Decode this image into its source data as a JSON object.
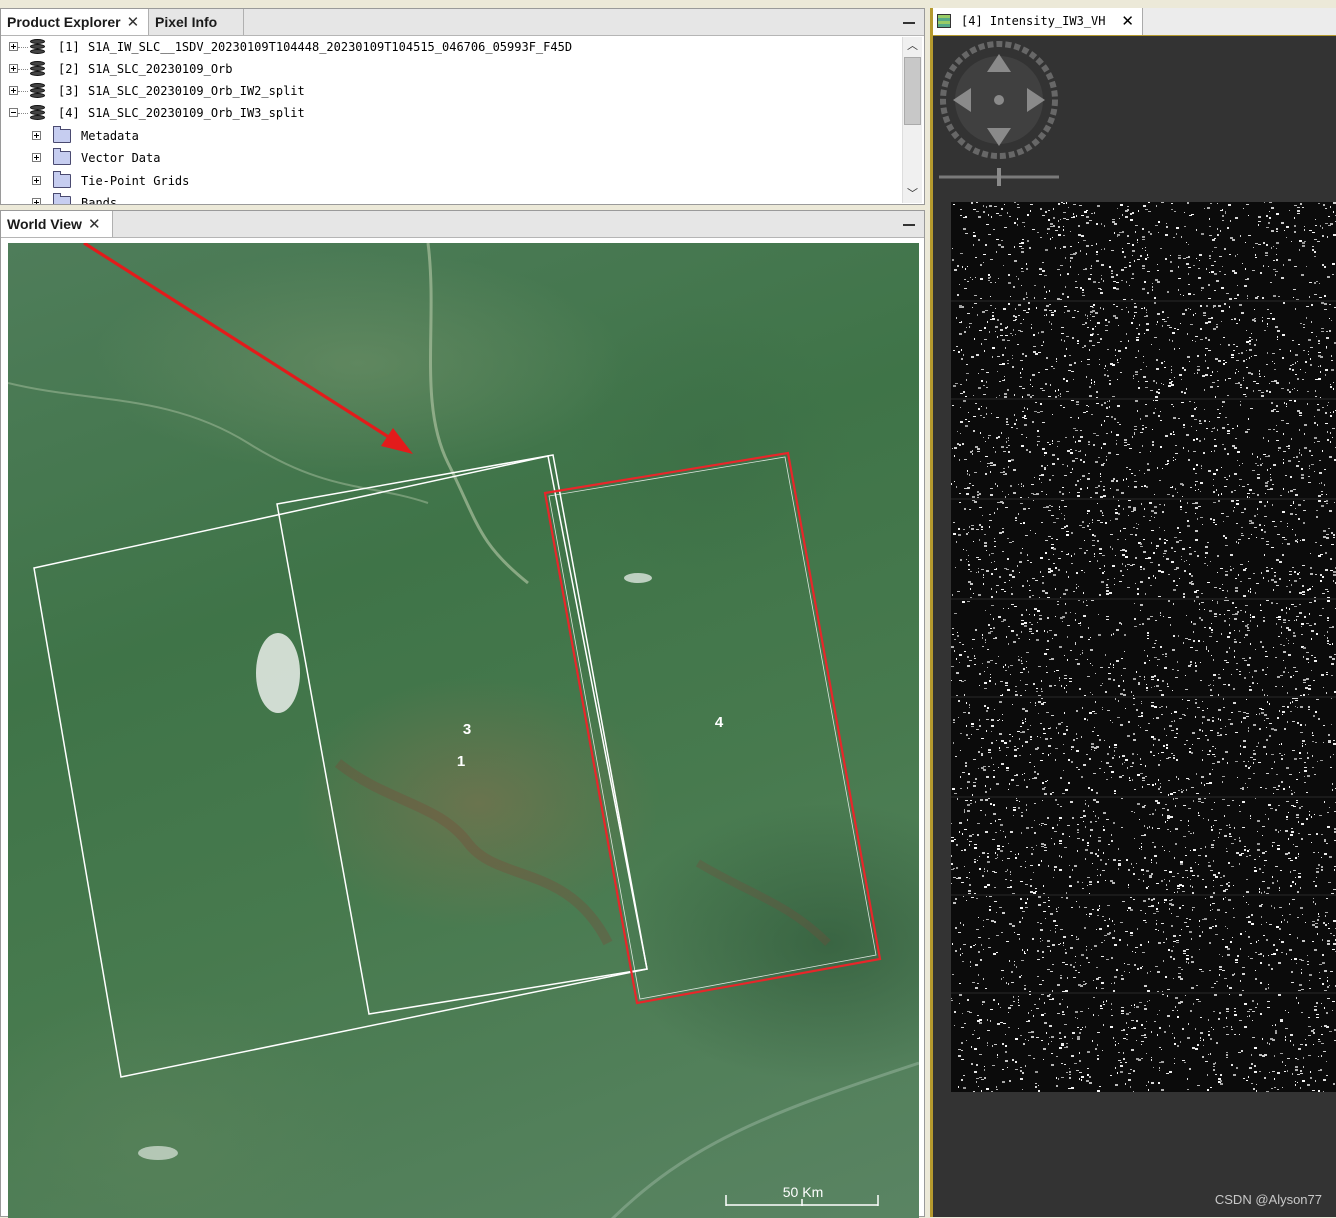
{
  "product_explorer": {
    "tabs": [
      {
        "label": "Product Explorer",
        "close": "✕"
      },
      {
        "label": "Pixel Info"
      }
    ],
    "products": [
      {
        "index": "[1]",
        "name": "S1A_IW_SLC__1SDV_20230109T104448_20230109T104515_046706_05993F_F45D"
      },
      {
        "index": "[2]",
        "name": "S1A_SLC_20230109_Orb"
      },
      {
        "index": "[3]",
        "name": "S1A_SLC_20230109_Orb_IW2_split"
      },
      {
        "index": "[4]",
        "name": "S1A_SLC_20230109_Orb_IW3_split"
      }
    ],
    "children": [
      "Metadata",
      "Vector Data",
      "Tie-Point Grids",
      "Bands"
    ]
  },
  "world_view": {
    "tab_label": "World View",
    "close": "✕",
    "footprint_labels": [
      "3",
      "1",
      "4"
    ],
    "scale_label": "50 Km",
    "colors": {
      "selected_footprint": "#e8262a",
      "footprint": "#ffffff",
      "arrow": "#e31b1b"
    }
  },
  "image_view": {
    "tab_label": "[4] Intensity_IW3_VH",
    "close": "✕"
  },
  "watermark": "CSDN @Alyson77"
}
